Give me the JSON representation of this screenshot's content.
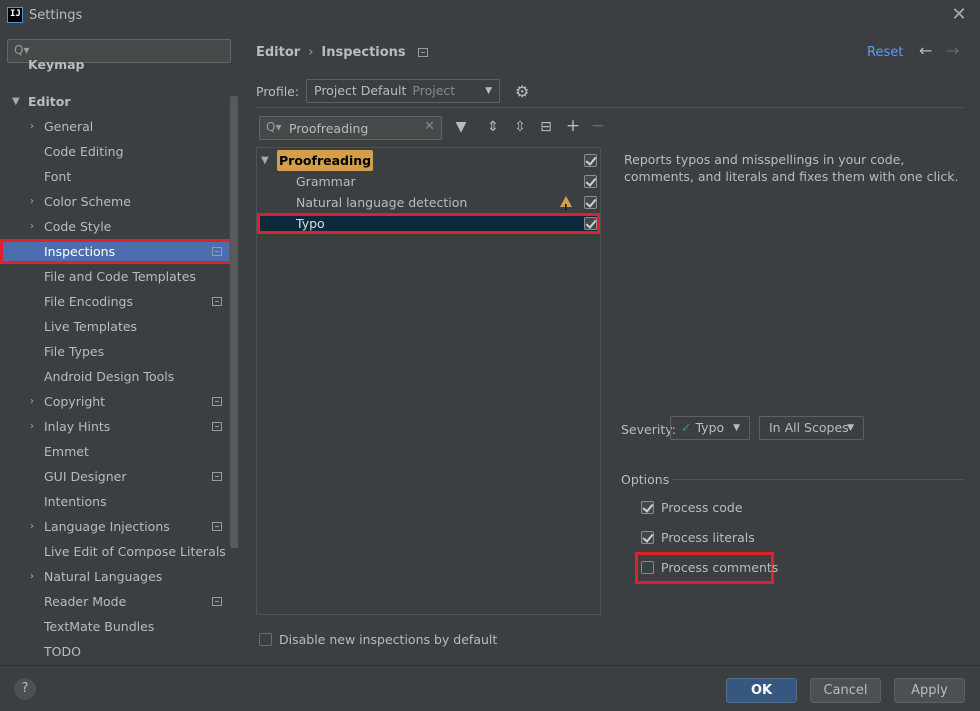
{
  "window": {
    "logo": "IJ",
    "title": "Settings",
    "close": "✕"
  },
  "sidebar": {
    "search_icon": "Q▾",
    "items": [
      {
        "label": "Keymap"
      },
      {
        "label": "Editor"
      },
      {
        "label": "General"
      },
      {
        "label": "Code Editing"
      },
      {
        "label": "Font"
      },
      {
        "label": "Color Scheme"
      },
      {
        "label": "Code Style"
      },
      {
        "label": "Inspections"
      },
      {
        "label": "File and Code Templates"
      },
      {
        "label": "File Encodings"
      },
      {
        "label": "Live Templates"
      },
      {
        "label": "File Types"
      },
      {
        "label": "Android Design Tools"
      },
      {
        "label": "Copyright"
      },
      {
        "label": "Inlay Hints"
      },
      {
        "label": "Emmet"
      },
      {
        "label": "GUI Designer"
      },
      {
        "label": "Intentions"
      },
      {
        "label": "Language Injections"
      },
      {
        "label": "Live Edit of Compose Literals"
      },
      {
        "label": "Natural Languages"
      },
      {
        "label": "Reader Mode"
      },
      {
        "label": "TextMate Bundles"
      },
      {
        "label": "TODO"
      }
    ]
  },
  "header": {
    "breadcrumb": [
      "Editor",
      "Inspections"
    ],
    "breadcrumb_sep": "›",
    "reset": "Reset",
    "back": "←",
    "forward": "→"
  },
  "profile": {
    "label": "Profile:",
    "value": "Project Default",
    "sub": "Project",
    "caret": "▼",
    "gear": "⚙"
  },
  "tree_search": {
    "icon": "Q▾",
    "value": "Proofreading",
    "clear": "✕"
  },
  "toolbar": {
    "filter": "▼",
    "expand": "⇕",
    "collapse": "⇳",
    "minus_box": "⊟",
    "add": "+",
    "remove": "−"
  },
  "tree": {
    "root": {
      "label": "Proofreading",
      "checked": true
    },
    "children": [
      {
        "label": "Grammar",
        "checked": true
      },
      {
        "label": "Natural language detection",
        "checked": true,
        "warning": true
      },
      {
        "label": "Typo",
        "checked": true,
        "selected": true
      }
    ]
  },
  "description": "Reports typos and misspellings in your code, comments, and literals and fixes them with one click.",
  "severity": {
    "label": "Severity:",
    "value": "Typo",
    "check": "✓",
    "caret": "▼"
  },
  "scope": {
    "value": "In All Scopes",
    "caret": "▼"
  },
  "options": {
    "label": "Options",
    "items": [
      {
        "label": "Process code",
        "checked": true
      },
      {
        "label": "Process literals",
        "checked": true
      },
      {
        "label": "Process comments",
        "checked": false
      }
    ]
  },
  "disable_new": {
    "label": "Disable new inspections by default",
    "checked": false
  },
  "footer": {
    "help": "?",
    "ok": "OK",
    "cancel": "Cancel",
    "apply": "Apply"
  },
  "colors": {
    "accent": "#4b6eaf",
    "link": "#589df6",
    "highlight": "#d2a04a",
    "annotation": "#e0212a",
    "ok": "#365880"
  }
}
